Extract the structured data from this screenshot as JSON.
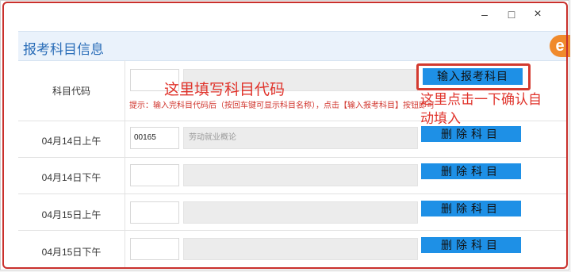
{
  "window": {
    "minimize_glyph": "–",
    "maximize_glyph": "□",
    "close_glyph": "×"
  },
  "panel": {
    "title": "报考科目信息",
    "logo_char": "e"
  },
  "code_row": {
    "label": "科目代码",
    "input_button_label": "输入报考科目",
    "hint": "提示：输入完科目代码后（按回车键可显示科目名称），点击【输入报考科目】按钮即可"
  },
  "annotations": {
    "fill_code": "这里填写科目代码",
    "click_autofill": "这里点击一下确认自动填入"
  },
  "rows": [
    {
      "label": "04月14日上午",
      "code": "00165",
      "name": "劳动就业概论",
      "button": "删除科目"
    },
    {
      "label": "04月14日下午",
      "code": "",
      "name": "",
      "button": "删除科目"
    },
    {
      "label": "04月15日上午",
      "code": "",
      "name": "",
      "button": "删除科目"
    },
    {
      "label": "04月15日下午",
      "code": "",
      "name": "",
      "button": "删除科目"
    }
  ],
  "colors": {
    "accent_blue": "#1e90e6",
    "annotation_red": "#e0332b",
    "title_blue": "#2a6db8"
  }
}
